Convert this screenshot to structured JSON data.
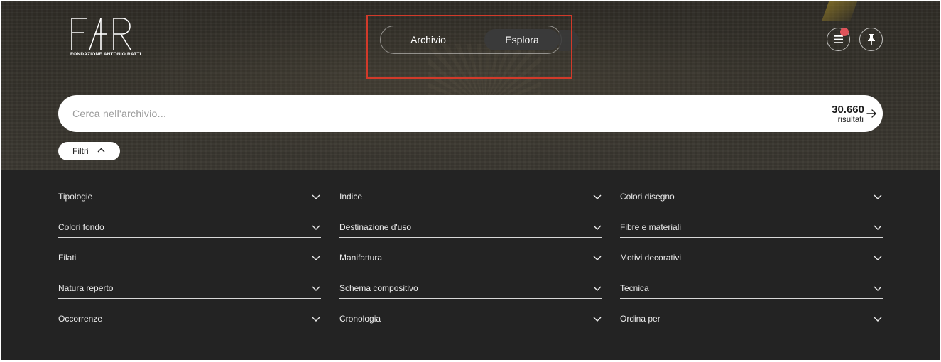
{
  "brand": {
    "logo_text": "FAR",
    "logo_subtitle": "FONDAZIONE ANTONIO RATTI"
  },
  "nav_toggle": {
    "options": [
      "Archivio",
      "Esplora"
    ],
    "active": "Esplora"
  },
  "header_icons": {
    "menu": "hamburger-menu-icon",
    "pin": "pushpin-icon",
    "notification": true
  },
  "search": {
    "placeholder": "Cerca nell'archivio...",
    "value": "",
    "results_count": "30.660",
    "results_label": "risultati",
    "submit_icon": "arrow-right-icon"
  },
  "filters_toggle": {
    "label": "Filtri",
    "icon": "chevron-up-icon"
  },
  "filters": {
    "col1": [
      "Tipologie",
      "Colori fondo",
      "Filati",
      "Natura reperto",
      "Occorrenze"
    ],
    "col2": [
      "Indice",
      "Destinazione d'uso",
      "Manifattura",
      "Schema compositivo",
      "Cronologia"
    ],
    "col3": [
      "Colori disegno",
      "Fibre e materiali",
      "Motivi decorativi",
      "Tecnica",
      "Ordina per"
    ]
  },
  "colors": {
    "panel": "#232323",
    "highlight": "#d23a2a",
    "notification": "#e0535a"
  }
}
